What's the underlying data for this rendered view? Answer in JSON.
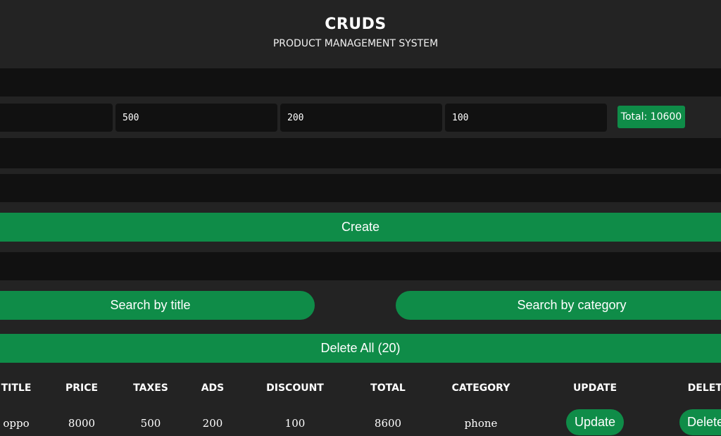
{
  "header": {
    "title": "CRUDS",
    "subtitle": "PRODUCT MANAGEMENT SYSTEM"
  },
  "form": {
    "title_value": "",
    "price_value": "",
    "taxes_value": "500",
    "ads_value": "200",
    "discount_value": "100",
    "total_label": "Total: 10600",
    "count_value": "",
    "category_value": "",
    "create_label": "Create"
  },
  "search": {
    "value": "",
    "by_title_label": "Search by title",
    "by_category_label": "Search by category"
  },
  "delete_all_label": "Delete All (20)",
  "table": {
    "headers": [
      "TITLE",
      "PRICE",
      "TAXES",
      "ADS",
      "DISCOUNT",
      "TOTAL",
      "CATEGORY",
      "UPDATE",
      "DELETE"
    ],
    "rows": [
      {
        "title": "oppo",
        "price": "8000",
        "taxes": "500",
        "ads": "200",
        "discount": "100",
        "total": "8600",
        "category": "phone",
        "update_label": "Update",
        "delete_label": "Delete"
      }
    ]
  },
  "colors": {
    "background": "#232323",
    "input_background": "#111111",
    "accent_green": "#0f8c48"
  }
}
